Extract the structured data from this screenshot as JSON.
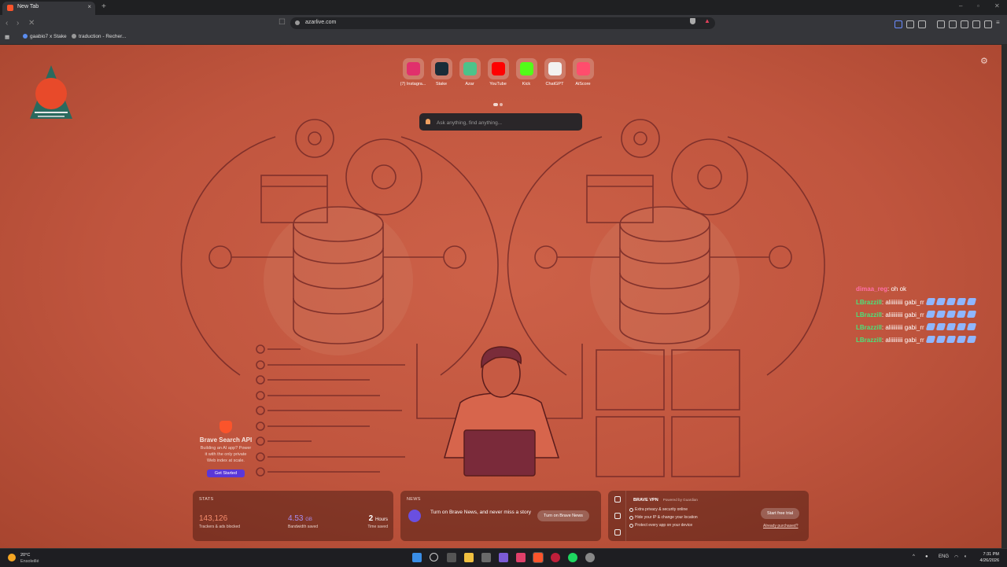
{
  "tab": {
    "title": "New Tab",
    "close": "×",
    "new_tab": "+"
  },
  "window_controls": {
    "minimize": "–",
    "maximize": "▫",
    "close": "✕"
  },
  "address": {
    "url": "azarlive.com"
  },
  "nav": {
    "back": "‹",
    "forward": "›",
    "reload": "✕"
  },
  "bookmarks": [
    {
      "label": "gaabio7 x Stake"
    },
    {
      "label": "traduction - Recher..."
    }
  ],
  "top_sites": [
    {
      "label": "(7) Instagra...",
      "icon": "instagram-icon",
      "color": "#e1306c"
    },
    {
      "label": "Stake",
      "icon": "stake-icon",
      "color": "#1a2c38"
    },
    {
      "label": "Azar",
      "icon": "azar-icon",
      "color": "#4cc38a"
    },
    {
      "label": "YouTube",
      "icon": "youtube-icon",
      "color": "#ff0000"
    },
    {
      "label": "Kick",
      "icon": "kick-icon",
      "color": "#53fc18"
    },
    {
      "label": "ChatGPT",
      "icon": "chatgpt-icon",
      "color": "#ffffff"
    },
    {
      "label": "AiScore",
      "icon": "aiscore-icon",
      "color": "#ff4d6d"
    }
  ],
  "search": {
    "placeholder": "Ask anything, find anything..."
  },
  "chat": [
    {
      "user": "dimaa_reg",
      "text": ": oh ok",
      "user_color": "#ff6fa8",
      "emotes": 0
    },
    {
      "user": "LBrazzill",
      "text": ": aliiiiiiiii gabi_rr",
      "user_color": "#4be37a",
      "emotes": 5
    },
    {
      "user": "LBrazzill",
      "text": ": aliiiiiiiii gabi_rr",
      "user_color": "#4be37a",
      "emotes": 5
    },
    {
      "user": "LBrazzill",
      "text": ": aliiiiiiiii gabi_rr",
      "user_color": "#4be37a",
      "emotes": 5
    },
    {
      "user": "LBrazzill",
      "text": ": aliiiiiiiii gabi_rr",
      "user_color": "#4be37a",
      "emotes": 5
    }
  ],
  "brave_api": {
    "title": "Brave Search API",
    "desc1": "Building an AI app? Power",
    "desc2": "it with the only private",
    "desc3": "Web index at scale.",
    "button": "Get Started"
  },
  "stats": {
    "header": "STATS",
    "trackers_value": "143,126",
    "trackers_label": "Trackers & ads blocked",
    "bandwidth_value": "4.53",
    "bandwidth_unit": "GB",
    "bandwidth_label": "Bandwidth saved",
    "time_value": "2",
    "time_unit": "Hours",
    "time_label": "Time saved",
    "accent_trackers": "#f58c6c",
    "accent_bandwidth": "#a98cf0"
  },
  "news": {
    "header": "NEWS",
    "text": "Turn on Brave News, and never miss a story",
    "button": "Turn on Brave News"
  },
  "vpn": {
    "title": "BRAVE VPN",
    "powered": "Powered by Guardian",
    "items": [
      "Extra privacy & security online",
      "Hide your IP & change your location",
      "Protect every app on your device"
    ],
    "button": "Start free trial",
    "link": "Already purchased?"
  },
  "taskbar": {
    "temp": "20°C",
    "condition": "Ensoleillé",
    "lang": "ENG",
    "time": "7:31 PM",
    "date": "4/26/2026"
  }
}
